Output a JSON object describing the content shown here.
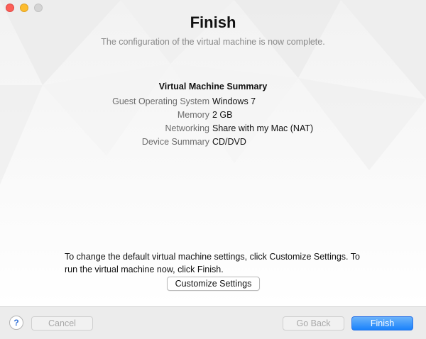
{
  "window": {
    "title": "Finish",
    "subtitle": "The configuration of the virtual machine is now complete."
  },
  "summary": {
    "heading": "Virtual Machine Summary",
    "rows": [
      {
        "label": "Guest Operating System",
        "value": "Windows 7"
      },
      {
        "label": "Memory",
        "value": "2 GB"
      },
      {
        "label": "Networking",
        "value": "Share with my Mac (NAT)"
      },
      {
        "label": "Device Summary",
        "value": "CD/DVD"
      }
    ]
  },
  "info_text": "To change the default virtual machine settings, click Customize Settings. To run the virtual machine now, click Finish.",
  "buttons": {
    "customize": "Customize Settings",
    "help": "?",
    "cancel": "Cancel",
    "go_back": "Go Back",
    "finish": "Finish"
  },
  "colors": {
    "accent": "#1a82fb",
    "close": "#fc5f57",
    "minimize": "#fdbc2e"
  }
}
